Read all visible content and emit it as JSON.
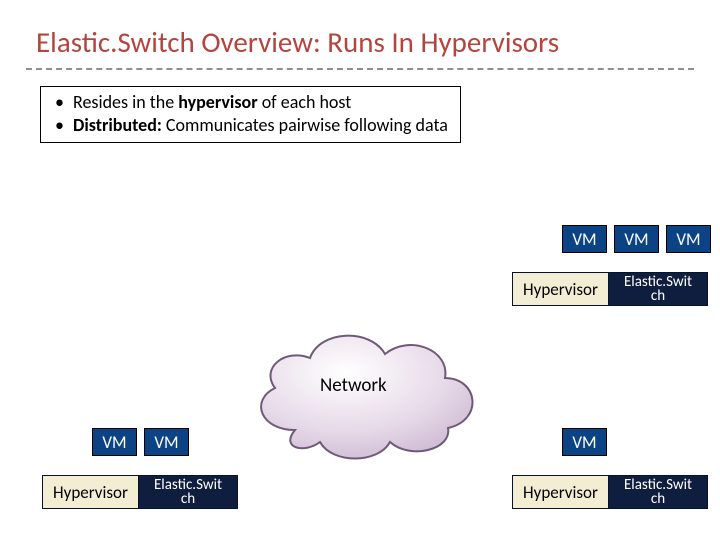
{
  "title": "Elastic.Switch Overview: Runs In Hypervisors",
  "bullets": {
    "b1_pre": "Resides in the ",
    "b1_strong": "hypervisor",
    "b1_post": " of each host",
    "b2_strong": "Distributed:",
    "b2_post": " Communicates pairwise following data"
  },
  "labels": {
    "vm": "VM",
    "hypervisor": "Hypervisor",
    "es_l1": "Elastic.Swit",
    "es_l2": "ch",
    "network": "Network"
  }
}
